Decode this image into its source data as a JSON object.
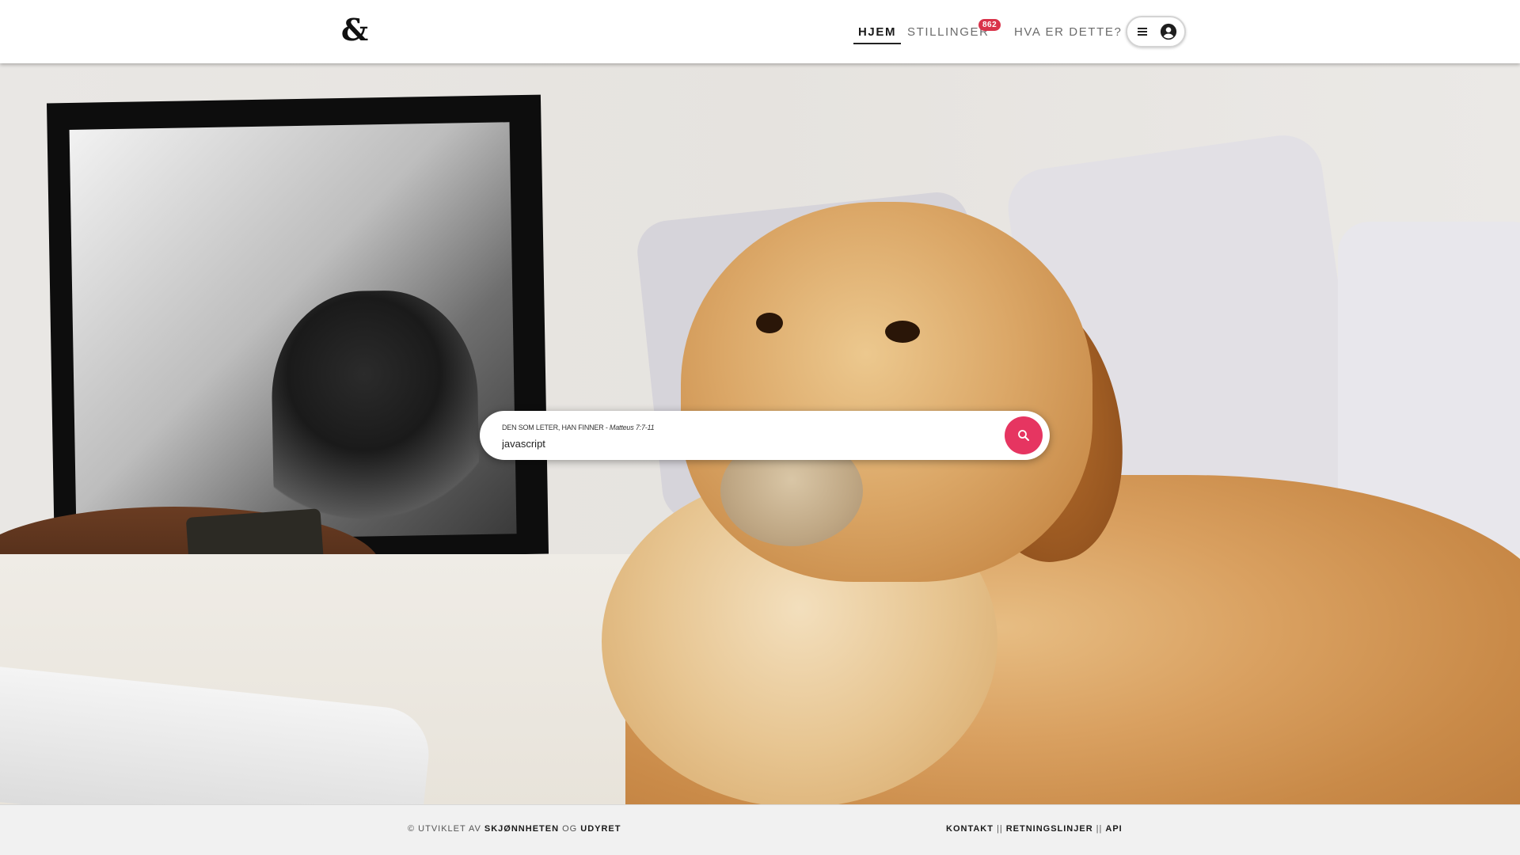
{
  "header": {
    "logo": "&",
    "nav": {
      "home": "HJEM",
      "jobs": "STILLINGER",
      "jobs_count": "862",
      "about": "HVA ER DETTE?"
    },
    "icons": [
      "hamburger-menu-icon",
      "account-circle-icon"
    ]
  },
  "search": {
    "label_text": "DEN SOM LETER, HAN FINNER - ",
    "label_ref": "Matteus 7:7-11",
    "value": "javascript",
    "button_color": "#e63561"
  },
  "hero": {
    "image": "golden retriever lying on a bed"
  },
  "footer": {
    "prefix": "© UTVIKLET AV ",
    "beauty": "SKJØNNHETEN",
    "and": " OG ",
    "beast": "UDYRET",
    "links": [
      "KONTAKT",
      "RETNINGSLINJER",
      "API"
    ],
    "separator": "||"
  },
  "colors": {
    "accent": "#e63561",
    "badge": "#d9334a",
    "footer_bg": "#f1f1f1"
  }
}
